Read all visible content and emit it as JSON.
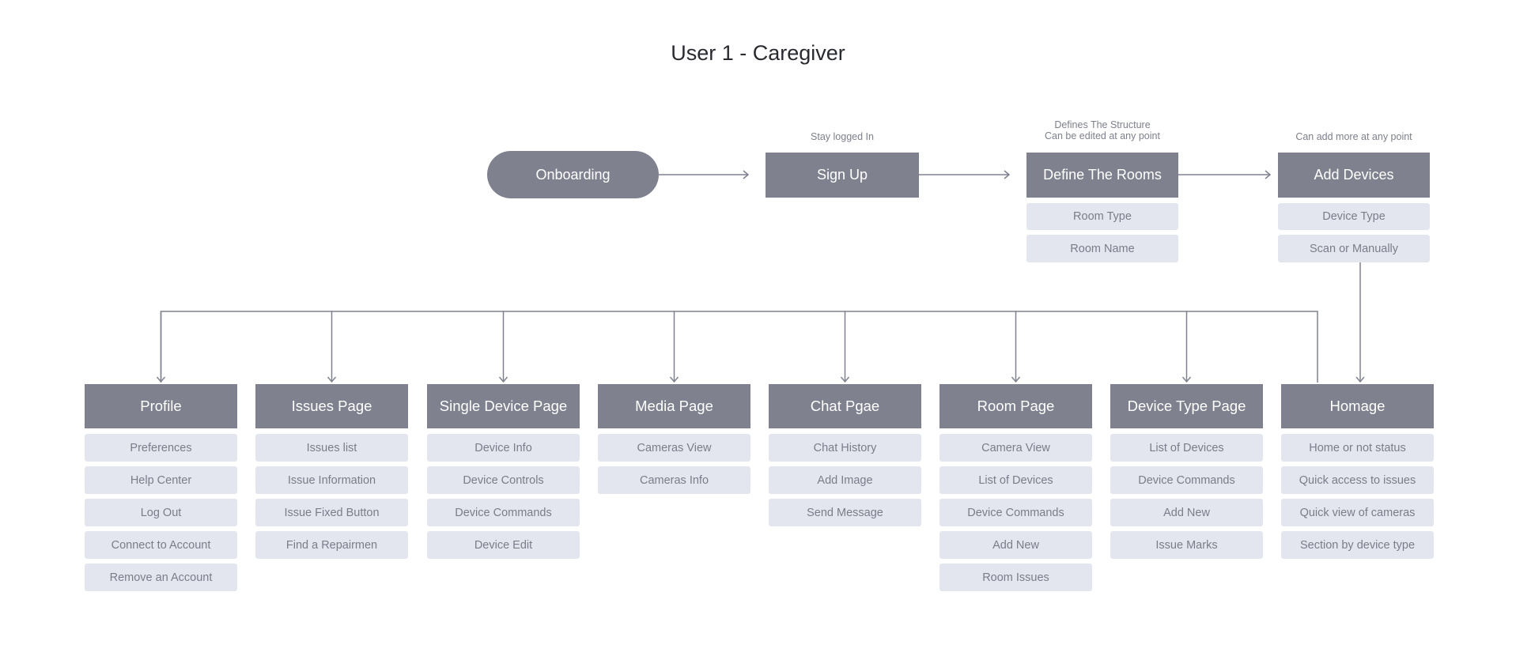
{
  "title": "User 1 - Caregiver",
  "colors": {
    "node": "#7f818f",
    "item": "#e4e6ef",
    "item_text": "#7a7c8a",
    "line": "#7f818f",
    "title": "#2a2b31"
  },
  "flow": {
    "onboarding": {
      "label": "Onboarding"
    },
    "signup": {
      "label": "Sign Up",
      "note": "Stay logged In"
    },
    "rooms": {
      "label": "Define The Rooms",
      "note_line1": "Defines The Structure",
      "note_line2": "Can be edited at any point",
      "items": [
        "Room Type",
        "Room Name"
      ]
    },
    "devices": {
      "label": "Add Devices",
      "note": "Can add more at any point",
      "items": [
        "Device Type",
        "Scan or Manually"
      ]
    }
  },
  "pages": [
    {
      "label": "Profile",
      "items": [
        "Preferences",
        "Help Center",
        "Log Out",
        "Connect to Account",
        "Remove an Account"
      ]
    },
    {
      "label": "Issues Page",
      "items": [
        "Issues list",
        "Issue Information",
        "Issue Fixed Button",
        "Find a Repairmen"
      ]
    },
    {
      "label": "Single Device Page",
      "items": [
        "Device Info",
        "Device Controls",
        "Device Commands",
        "Device Edit"
      ]
    },
    {
      "label": "Media Page",
      "items": [
        "Cameras View",
        "Cameras Info"
      ]
    },
    {
      "label": "Chat Pgae",
      "items": [
        "Chat History",
        "Add Image",
        "Send Message"
      ]
    },
    {
      "label": "Room Page",
      "items": [
        "Camera View",
        "List of Devices",
        "Device Commands",
        "Add New",
        "Room Issues"
      ]
    },
    {
      "label": "Device Type Page",
      "items": [
        "List of Devices",
        "Device Commands",
        "Add New",
        "Issue Marks"
      ]
    },
    {
      "label": "Homage",
      "items": [
        "Home or not status",
        "Quick access to issues",
        "Quick view of cameras",
        "Section by device type"
      ]
    }
  ]
}
